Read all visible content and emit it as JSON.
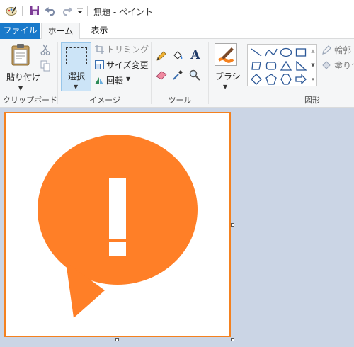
{
  "window": {
    "title": "無題 - ペイント",
    "quick_access": [
      "paint-app-icon",
      "save-icon",
      "undo-icon",
      "redo-icon",
      "customize-dropdown-icon"
    ]
  },
  "tabs": [
    {
      "label": "ファイル",
      "active": false
    },
    {
      "label": "ホーム",
      "active": true
    },
    {
      "label": "表示",
      "active": false
    }
  ],
  "ribbon": {
    "clipboard": {
      "paste_label": "貼り付け",
      "group_label": "クリップボード",
      "icons": [
        "paste-icon",
        "cut-icon",
        "copy-icon"
      ]
    },
    "image": {
      "select_label": "選択",
      "crop_label": "トリミング",
      "resize_label": "サイズ変更",
      "rotate_label": "回転",
      "group_label": "イメージ"
    },
    "tools": {
      "group_label": "ツール",
      "icons": [
        "pencil-icon",
        "fill-icon",
        "text-icon",
        "eraser-icon",
        "color-picker-icon",
        "magnifier-icon"
      ]
    },
    "brushes": {
      "label": "ブラシ"
    },
    "shapes": {
      "group_label": "図形",
      "outline_label": "輪郭",
      "fill_label": "塗りつ",
      "icons": [
        "line-shape-icon",
        "curve-shape-icon",
        "oval-shape-icon",
        "rectangle-shape-icon",
        "polygon-shape-icon",
        "rounded-rectangle-shape-icon",
        "triangle-shape-icon",
        "right-triangle-shape-icon",
        "diamond-shape-icon",
        "pentagon-shape-icon",
        "hexagon-shape-icon",
        "right-arrow-shape-icon"
      ]
    }
  },
  "canvas": {
    "content": "orange speech bubble with exclamation mark",
    "accent_color": "#ff7f27",
    "selection_color": "#f4811f"
  }
}
